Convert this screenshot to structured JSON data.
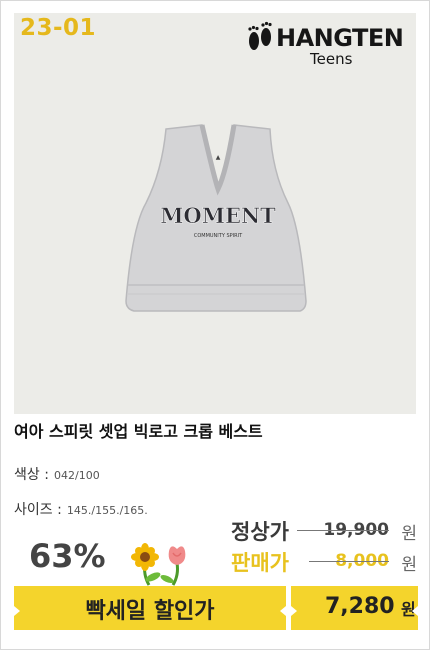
{
  "product": {
    "code": "23-01",
    "brand_name": "HANGTEN",
    "brand_sub": "Teens",
    "graphic_text": "MOMENT",
    "graphic_sub": "COMMUNITY SPIRIT",
    "title": "여아 스피릿 셋업 빅로고 크롭 베스트",
    "color_label": "색상 :",
    "color_value": "042/100",
    "size_label": "사이즈 :",
    "size_value": "145./155./165."
  },
  "pricing": {
    "discount": "63%",
    "regular_label": "정상가",
    "regular_price": "19,900",
    "sale_label": "판매가",
    "sale_price": "8,000",
    "currency": "원",
    "banner_label": "빡세일 할인가",
    "final_price": "7,280",
    "final_currency": "원"
  },
  "colors": {
    "accent_yellow": "#f4d42c",
    "code_gold": "#e5b81c",
    "regular_label": "#3a3a3a",
    "sale_label": "#e8c21e",
    "vest_gray": "#d4d4d6"
  }
}
